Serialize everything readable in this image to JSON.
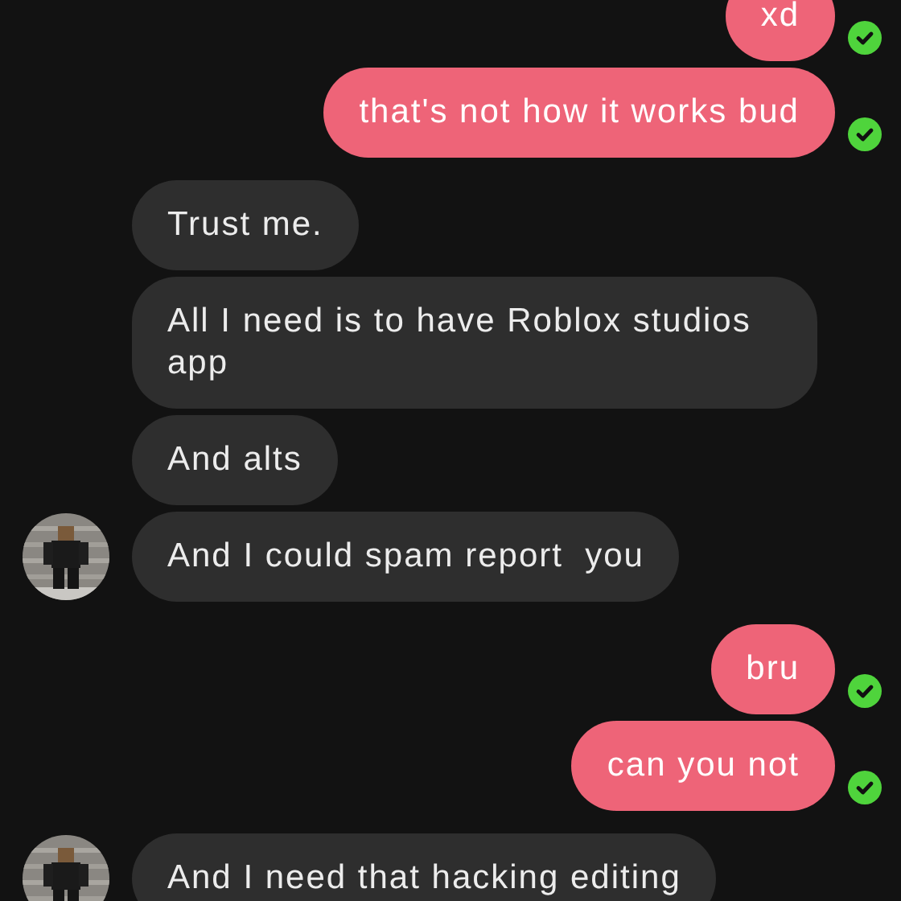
{
  "messages": [
    {
      "kind": "sent",
      "text": "xd",
      "delivered": true
    },
    {
      "kind": "sent",
      "text": "that's not how it works bud",
      "delivered": true
    },
    {
      "kind": "received",
      "text": "Trust me.",
      "show_avatar": false
    },
    {
      "kind": "received",
      "text": "All I need is to have Roblox studios app",
      "show_avatar": false
    },
    {
      "kind": "received",
      "text": "And alts",
      "show_avatar": false
    },
    {
      "kind": "received",
      "text": "And I could spam report  you",
      "show_avatar": true
    },
    {
      "kind": "sent",
      "text": "bru",
      "delivered": true
    },
    {
      "kind": "sent",
      "text": "can you not",
      "delivered": true
    },
    {
      "kind": "received",
      "text": "And I need that hacking editing",
      "show_avatar": true
    }
  ]
}
